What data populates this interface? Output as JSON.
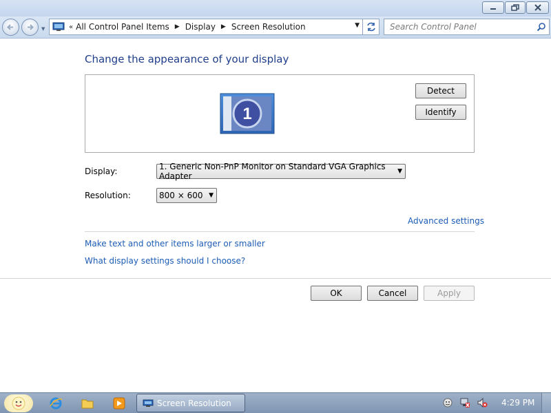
{
  "window": {
    "controls": {
      "minimize_icon": "minimize-icon",
      "maximize_icon": "restore-icon",
      "close_icon": "close-icon"
    }
  },
  "address_bar": {
    "overflow": "«",
    "breadcrumbs": [
      "All Control Panel Items",
      "Display",
      "Screen Resolution"
    ]
  },
  "search": {
    "placeholder": "Search Control Panel"
  },
  "main": {
    "heading": "Change the appearance of your display",
    "monitor_number": "1",
    "detect_label": "Detect",
    "identify_label": "Identify",
    "display_label": "Display:",
    "display_value": "1. Generic Non-PnP Monitor on Standard VGA Graphics Adapter",
    "resolution_label": "Resolution:",
    "resolution_value": "800 × 600",
    "advanced_link": "Advanced settings",
    "link_text_size": "Make text and other items larger or smaller",
    "link_help": "What display settings should I choose?"
  },
  "footer": {
    "ok": "OK",
    "cancel": "Cancel",
    "apply": "Apply"
  },
  "taskbar": {
    "task_label": "Screen Resolution",
    "clock": "4:29 PM",
    "pinned": [
      "internet-explorer-icon",
      "folder-icon",
      "media-player-icon"
    ],
    "tray": [
      "messenger-icon",
      "network-icon",
      "volume-muted-icon"
    ]
  },
  "colors": {
    "heading": "#1e3d8a",
    "link": "#1c5cb6",
    "taskbar": "#8ea2bc"
  }
}
